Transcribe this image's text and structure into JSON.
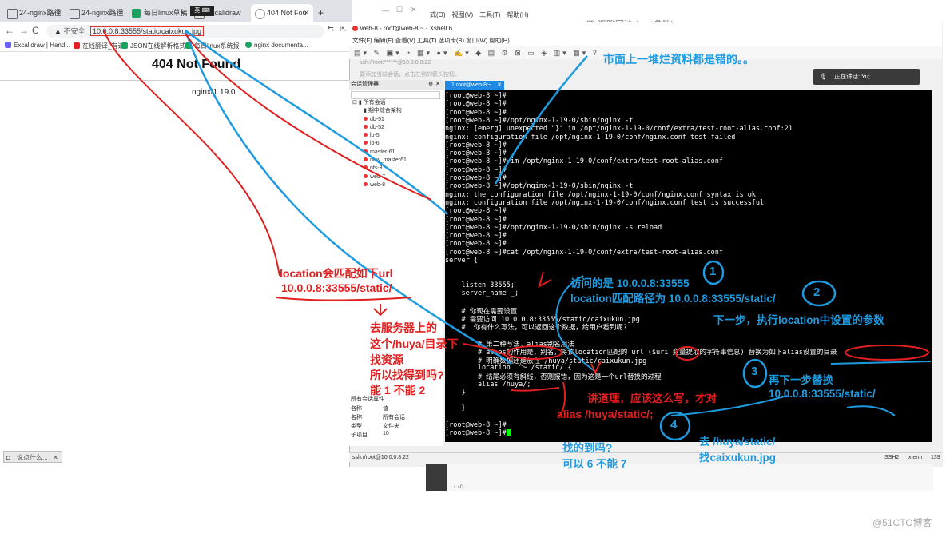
{
  "browser": {
    "tabs": [
      {
        "label": "24-nginx路径",
        "color": "#666"
      },
      {
        "label": "24-nginx路径",
        "color": "#666"
      },
      {
        "label": "每日linux草稿",
        "color": "#1aa260"
      },
      {
        "label": "Excalidraw",
        "color": "#666"
      },
      {
        "label": "404 Not Fou",
        "color": "#666"
      }
    ],
    "new_tab": "+",
    "insecure_label": "不安全",
    "url": "10.0.0.8:33555/static/caixukun.jpg",
    "bookmarks": [
      {
        "label": "Excalidraw | Hand...",
        "color": "#6c63ff"
      },
      {
        "label": "在线翻译_有道",
        "color": "#e02020"
      },
      {
        "label": "JSON在线解析格式化",
        "color": "#1aa260"
      },
      {
        "label": "每日linux系统报",
        "color": "#1aa260"
      },
      {
        "label": "nginx documenta...",
        "color": "#1aa260"
      }
    ],
    "heading": "404 Not Found",
    "server": "nginx/1.19.0",
    "task_chip": "说点什么..."
  },
  "xshell": {
    "title": "web-8 - root@web-8:~ - Xshell 6",
    "menu": [
      "文件(F)",
      "编辑(E)",
      "查看(V)",
      "工具(T)",
      "选项卡(B)",
      "窗口(W)",
      "帮助(H)"
    ],
    "address": "ssh://root:******@10.0.0.8:22",
    "hint": "要添加当前会话，点击左侧的箭头按钮。",
    "speaking": "正在讲话: Yu;",
    "sessions_header": "会话管理器",
    "sessions_root": "所有会话",
    "sessions": [
      "期中综合架构",
      "db-51",
      "db-52",
      "lb-5",
      "lb-6",
      "master-61",
      "new_master61",
      "nfs-31",
      "web-7",
      "web-8"
    ],
    "props_header": "所有会话属性",
    "props": [
      {
        "k": "名称",
        "v": "值"
      },
      {
        "k": "名称",
        "v": "所有会话"
      },
      {
        "k": "类型",
        "v": "文件夹"
      },
      {
        "k": "子项目",
        "v": "10"
      }
    ],
    "tab_label": "1 root@web-8:~",
    "status_left": "ssh://root@10.0.0.8:22",
    "status_right": [
      "SSH2",
      "xterm",
      "139"
    ],
    "terminal_lines": [
      "[root@web-8 ~]#",
      "[root@web-8 ~]#",
      "[root@web-8 ~]#",
      "[root@web-8 ~]#/opt/nginx-1-19-0/sbin/nginx -t",
      "nginx: [emerg] unexpected \"}\" in /opt/nginx-1-19-0/conf/extra/test-root-alias.conf:21",
      "nginx: configuration file /opt/nginx-1-19-0/conf/nginx.conf test failed",
      "[root@web-8 ~]#",
      "[root@web-8 ~]#",
      "[root@web-8 ~]#vim /opt/nginx-1-19-0/conf/extra/test-root-alias.conf",
      "[root@web-8 ~]#",
      "[root@web-8 ~]#",
      "[root@web-8 ~]#/opt/nginx-1-19-0/sbin/nginx -t",
      "nginx: the configuration file /opt/nginx-1-19-0/conf/nginx.conf syntax is ok",
      "nginx: configuration file /opt/nginx-1-19-0/conf/nginx.conf test is successful",
      "[root@web-8 ~]#",
      "[root@web-8 ~]#",
      "[root@web-8 ~]#/opt/nginx-1-19-0/sbin/nginx -s reload",
      "[root@web-8 ~]#",
      "[root@web-8 ~]#",
      "[root@web-8 ~]#cat /opt/nginx-1-19-0/conf/extra/test-root-alias.conf",
      "server {",
      "",
      "",
      "    listen 33555;",
      "    server_name _;",
      "",
      "    # 你现在需要设置",
      "    # 需要访问 10.0.0.8:33555/static/caixukun.jpg",
      "    #  你有什么写法，可以返回这个数据，给用户看到呢?",
      "",
      "        # 第二种写法，alias别名用法",
      "        # alias的作用是，别名，将该location匹配的 url ($uri 变量提取的字符串信息) 替换为如下alias设置的目录",
      "        # 明确数据还是放在 /huya/static/caixukun.jpg",
      "        location  ^~ /static/ {",
      "        # 结尾必须有斜线，否则报错，因为这是一个url替换的过程",
      "        alias /huya/;",
      "    }",
      "",
      "    }",
      "",
      "[root@web-8 ~]#",
      "[root@web-8 ~]#"
    ],
    "top_text": "四 汇聊写法 (root参数)"
  },
  "annotations": {
    "market": "市面上一堆烂资料都是错的。。",
    "loc_match_1": "location会匹配如下url",
    "loc_match_2": "10.0.0.8:33555/static/",
    "server_dir_1": "去服务器上的",
    "server_dir_2": "这个/huya/目录下",
    "server_dir_3": "找资源",
    "server_dir_4": "所以找得到吗?",
    "server_dir_5": "能 1  不能 2",
    "visit_1": "访问的是 10.0.0.8:33555",
    "visit_2": "location匹配路径为  10.0.0.8:33555/static/",
    "next_step": "下一步，执行location中设置的参数",
    "replace_1": "再下一步替换",
    "replace_2": "10.0.0.8:33555/static/",
    "should_write": "讲道理，应该这么写，才对",
    "alias_fix": "alias  /huya/static/;",
    "go_to_1": "去 /huya/static/",
    "go_to_2": "找caixukun.jpg",
    "found_1": "找的到吗?",
    "found_2": "可以 6 不能 7",
    "circle_1": "1",
    "circle_2": "2",
    "circle_3": "3",
    "circle_4": "4",
    "annotation_colors": {
      "red": "#e02020",
      "blue": "#1e9be0"
    }
  },
  "watermark": "@51CTO博客"
}
